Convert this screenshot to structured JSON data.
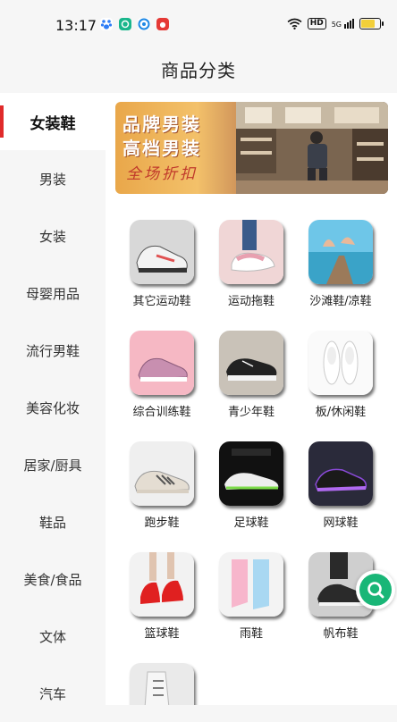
{
  "status_bar": {
    "time": "13:17",
    "hd_label": "HD",
    "signal_label": "5G",
    "battery_level_percent": 75,
    "app_icons": [
      "baidu-paw-icon",
      "green-app-icon",
      "blue-browser-icon",
      "red-shop-icon"
    ],
    "app_icon_colors": [
      "#2f7df6",
      "#19b68c",
      "#1e88e5",
      "#e53935"
    ]
  },
  "header": {
    "title": "商品分类"
  },
  "sidebar": {
    "items": [
      {
        "label": "女装鞋",
        "active": true
      },
      {
        "label": "男装",
        "active": false
      },
      {
        "label": "女装",
        "active": false
      },
      {
        "label": "母婴用品",
        "active": false
      },
      {
        "label": "流行男鞋",
        "active": false
      },
      {
        "label": "美容化妆",
        "active": false
      },
      {
        "label": "居家/厨具",
        "active": false
      },
      {
        "label": "鞋品",
        "active": false
      },
      {
        "label": "美食/食品",
        "active": false
      },
      {
        "label": "文体",
        "active": false
      },
      {
        "label": "汽车",
        "active": false
      }
    ],
    "accent_color": "#e02a2a"
  },
  "banner": {
    "line1": "品牌男装",
    "line2": "高档男装",
    "line3": "全场折扣"
  },
  "categories": [
    {
      "label": "其它运动鞋",
      "icon": "white-sneaker-image"
    },
    {
      "label": "运动拖鞋",
      "icon": "slipper-image"
    },
    {
      "label": "沙滩鞋/凉鞋",
      "icon": "beach-feet-image"
    },
    {
      "label": "综合训练鞋",
      "icon": "pink-trainer-image"
    },
    {
      "label": "青少年鞋",
      "icon": "black-canvas-shoe-image"
    },
    {
      "label": "板/休闲鞋",
      "icon": "white-slipon-image"
    },
    {
      "label": "跑步鞋",
      "icon": "grey-runner-image"
    },
    {
      "label": "足球鞋",
      "icon": "football-boot-image"
    },
    {
      "label": "网球鞋",
      "icon": "purple-sneaker-image"
    },
    {
      "label": "篮球鞋",
      "icon": "red-sneaker-image"
    },
    {
      "label": "雨鞋",
      "icon": "rain-boot-image"
    },
    {
      "label": "帆布鞋",
      "icon": "canvas-shoe-image"
    },
    {
      "label": "",
      "icon": "white-boot-image"
    }
  ],
  "fab": {
    "icon": "search-icon",
    "color": "#19b677"
  }
}
